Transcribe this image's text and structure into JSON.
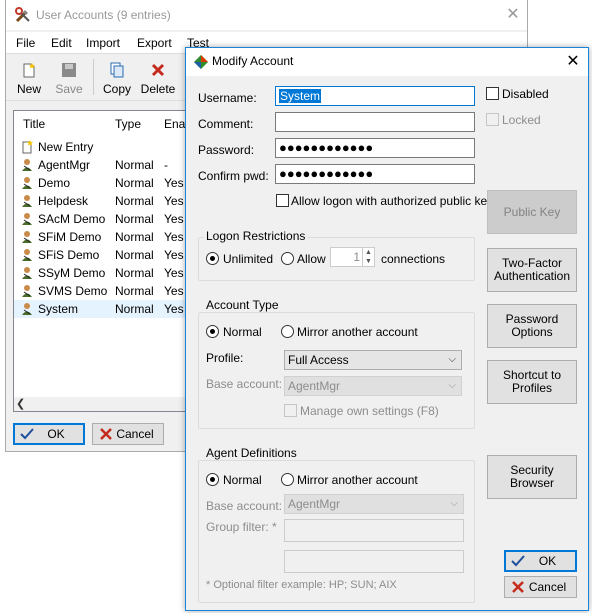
{
  "background_window": {
    "title": "User Accounts (9 entries)",
    "menu": [
      "File",
      "Edit",
      "Import",
      "Export",
      "Test"
    ],
    "toolbar": [
      {
        "label": "New",
        "icon": "new-entry-icon",
        "enabled": true
      },
      {
        "label": "Save",
        "icon": "save-icon",
        "enabled": false
      },
      {
        "label": "Copy",
        "icon": "copy-icon",
        "enabled": true
      },
      {
        "label": "Delete",
        "icon": "delete-icon",
        "enabled": true
      }
    ],
    "list": {
      "columns": [
        "Title",
        "Type",
        "Enab"
      ],
      "rows": [
        {
          "title": "New Entry",
          "type": "",
          "enabled": "",
          "icon": "new-entry-icon"
        },
        {
          "title": "AgentMgr",
          "type": "Normal",
          "enabled": "-",
          "icon": "user-icon"
        },
        {
          "title": "Demo",
          "type": "Normal",
          "enabled": "Yes",
          "icon": "user-icon"
        },
        {
          "title": "Helpdesk",
          "type": "Normal",
          "enabled": "Yes",
          "icon": "user-icon"
        },
        {
          "title": "SAcM Demo",
          "type": "Normal",
          "enabled": "Yes",
          "icon": "user-icon"
        },
        {
          "title": "SFiM Demo",
          "type": "Normal",
          "enabled": "Yes",
          "icon": "user-icon"
        },
        {
          "title": "SFiS Demo",
          "type": "Normal",
          "enabled": "Yes",
          "icon": "user-icon"
        },
        {
          "title": "SSyM Demo",
          "type": "Normal",
          "enabled": "Yes",
          "icon": "user-icon"
        },
        {
          "title": "SVMS Demo",
          "type": "Normal",
          "enabled": "Yes",
          "icon": "user-icon"
        },
        {
          "title": "System",
          "type": "Normal",
          "enabled": "Yes",
          "icon": "user-icon",
          "selected": true
        }
      ]
    },
    "ok_label": "OK",
    "cancel_label": "Cancel"
  },
  "dialog": {
    "title": "Modify Account",
    "username_label": "Username:",
    "username_value": "System",
    "comment_label": "Comment:",
    "comment_value": "",
    "password_label": "Password:",
    "password_value": "●●●●●●●●●●●●",
    "confirm_label": "Confirm pwd:",
    "confirm_value": "●●●●●●●●●●●●",
    "allow_pubkey_label": "Allow logon with authorized public key",
    "allow_pubkey_checked": false,
    "disabled_label": "Disabled",
    "disabled_checked": false,
    "locked_label": "Locked",
    "locked_checked": false,
    "logon_restrictions": {
      "title": "Logon Restrictions",
      "unlimited_label": "Unlimited",
      "allow_label": "Allow",
      "connections_value": "1",
      "connections_label": "connections",
      "selected": "Unlimited"
    },
    "account_type": {
      "title": "Account Type",
      "normal_label": "Normal",
      "mirror_label": "Mirror another account",
      "selected": "Normal",
      "profile_label": "Profile:",
      "profile_value": "Full Access",
      "base_account_label": "Base account:",
      "base_account_value": "AgentMgr",
      "manage_settings_label": "Manage own settings (F8)"
    },
    "agent_definitions": {
      "title": "Agent Definitions",
      "normal_label": "Normal",
      "mirror_label": "Mirror another account",
      "selected": "Normal",
      "base_account_label": "Base account:",
      "base_account_value": "AgentMgr",
      "group_filter_label": "Group filter: *",
      "group_filter_value": "",
      "group_filter_value2": "",
      "footnote": "* Optional filter example: HP; SUN; AIX"
    },
    "side_buttons": {
      "public_key": "Public Key",
      "two_factor": "Two-Factor Authentication",
      "password_options": "Password Options",
      "shortcut_profiles": "Shortcut to Profiles",
      "security_browser": "Security Browser"
    },
    "ok_label": "OK",
    "cancel_label": "Cancel"
  },
  "colors": {
    "accent": "#0078d7",
    "selection": "#0078d7",
    "delete_red": "#c42b1c",
    "ok_check": "#1f4e9c"
  }
}
